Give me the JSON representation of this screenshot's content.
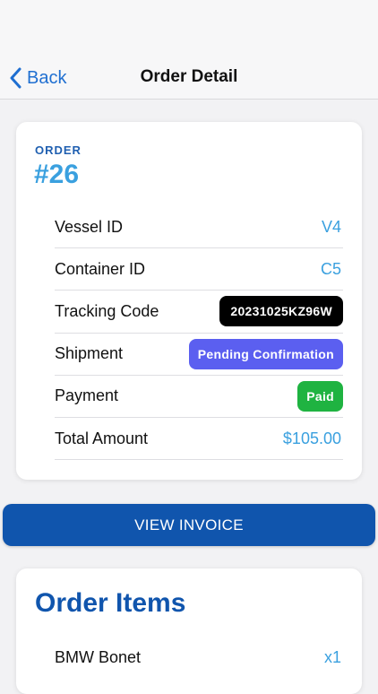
{
  "nav": {
    "back_label": "Back",
    "title": "Order Detail"
  },
  "order": {
    "label": "ORDER",
    "number": "#26",
    "rows": [
      {
        "label": "Vessel ID",
        "value": "V4"
      },
      {
        "label": "Container ID",
        "value": "C5"
      },
      {
        "label": "Tracking Code",
        "value": "20231025KZ96W"
      },
      {
        "label": "Shipment",
        "value": "Pending Confirmation"
      },
      {
        "label": "Payment",
        "value": "Paid"
      },
      {
        "label": "Total Amount",
        "value": "$105.00"
      }
    ]
  },
  "invoice_button": "VIEW INVOICE",
  "items": {
    "title": "Order Items",
    "list": [
      {
        "name": "BMW Bonet",
        "qty": "x1"
      }
    ]
  },
  "colors": {
    "accent_blue": "#1055ad",
    "value_blue": "#3aa0df",
    "pending_indigo": "#5b5ff0",
    "paid_green": "#1fb341",
    "tracking_black": "#000000"
  }
}
